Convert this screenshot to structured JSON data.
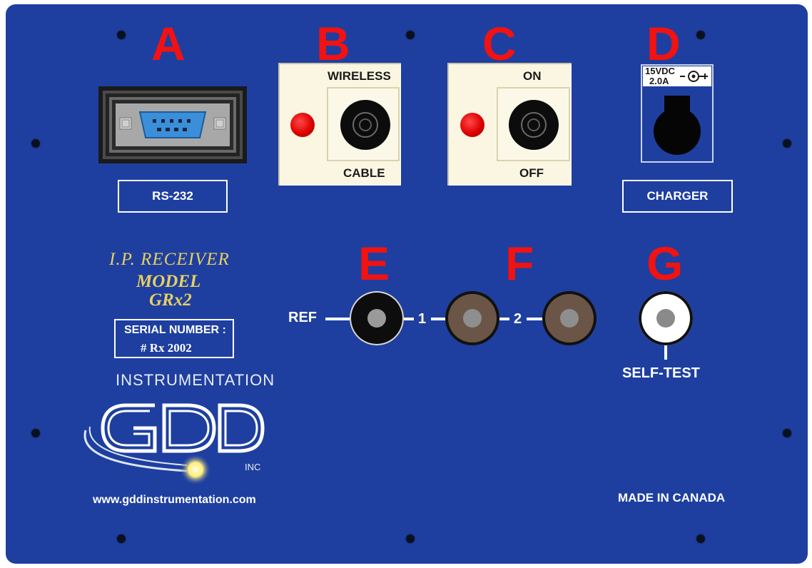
{
  "letters": {
    "a": "A",
    "b": "B",
    "c": "C",
    "d": "D",
    "e": "E",
    "f": "F",
    "g": "G"
  },
  "connector_a": {
    "label": "RS-232"
  },
  "switch_b": {
    "top_label": "WIRELESS",
    "bottom_label": "CABLE"
  },
  "switch_c": {
    "top_label": "ON",
    "bottom_label": "OFF"
  },
  "charger_d": {
    "rating_line1": "15VDC",
    "rating_line2": "2.0A",
    "label": "CHARGER"
  },
  "terminals": {
    "ref_label": "REF",
    "ch1_label": "1",
    "ch2_label": "2",
    "self_test_label": "SELF-TEST"
  },
  "device_info": {
    "receiver_text": "I.P. RECEIVER",
    "model_label": "MODEL",
    "model_name": "GRx2",
    "serial_label": "SERIAL NUMBER :",
    "serial_value": "# Rx 2002"
  },
  "brand": {
    "top_text": "INSTRUMENTATION",
    "logo_text": "GDD",
    "inc_text": "INC",
    "website": "www.gddinstrumentation.com"
  },
  "origin": "MADE IN CANADA",
  "colors": {
    "panel": "#1e3fa0",
    "letter_red": "#f11212",
    "gold": "#e8d060",
    "led_red": "#e00000"
  },
  "icons": [
    "screw-icon",
    "db9-connector-icon",
    "led-indicator-icon",
    "toggle-switch-icon",
    "dc-jack-icon",
    "polarity-symbol-icon",
    "banana-jack-icon",
    "gdd-logo-icon"
  ]
}
